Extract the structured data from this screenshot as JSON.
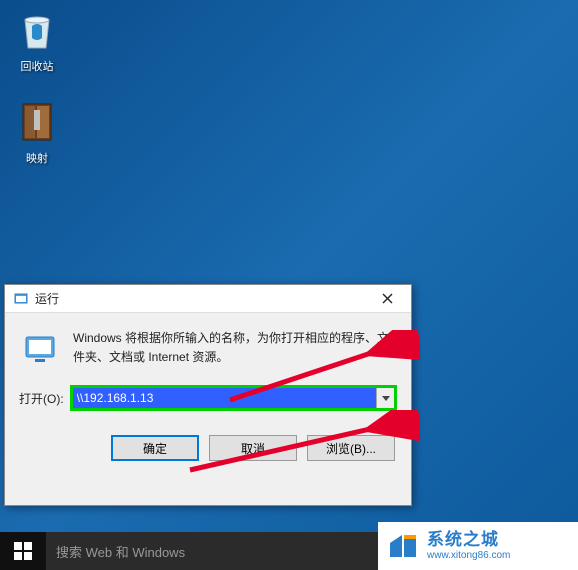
{
  "desktop": {
    "recycle_bin_label": "回收站",
    "mapping_label": "映射"
  },
  "dialog": {
    "title": "运行",
    "description": "Windows 将根据你所输入的名称，为你打开相应的程序、文件夹、文档或 Internet 资源。",
    "open_label": "打开(O):",
    "open_value": "\\\\192.168.1.13",
    "ok_label": "确定",
    "cancel_label": "取消",
    "browse_label": "浏览(B)..."
  },
  "taskbar": {
    "search_placeholder": "搜索 Web 和 Windows"
  },
  "watermark": {
    "title": "系统之城",
    "url": "www.xitong86.com"
  }
}
